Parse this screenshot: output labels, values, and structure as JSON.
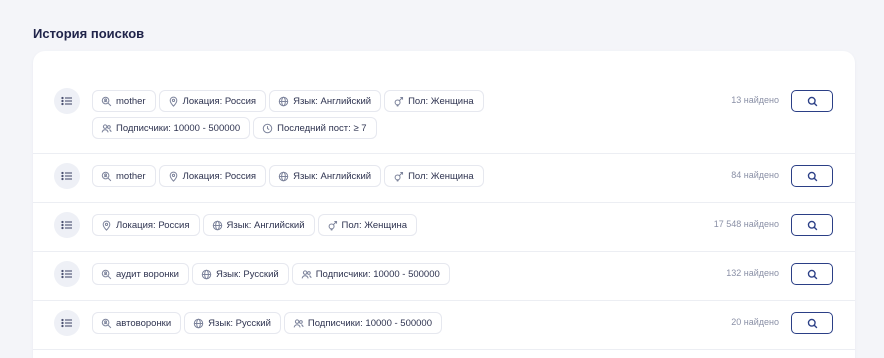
{
  "page": {
    "title": "История поисков"
  },
  "rows": [
    {
      "chips": [
        {
          "icon": "search-people-icon",
          "label": "mother"
        },
        {
          "icon": "location-pin-icon",
          "label": "Локация: Россия"
        },
        {
          "icon": "globe-icon",
          "label": "Язык: Английский"
        },
        {
          "icon": "gender-icon",
          "label": "Пол: Женщина"
        },
        {
          "icon": "followers-icon",
          "label": "Подписчики: 10000 - 500000"
        },
        {
          "icon": "clock-icon",
          "label": "Последний пост: ≥ 7"
        }
      ],
      "count": "13 найдено"
    },
    {
      "chips": [
        {
          "icon": "search-people-icon",
          "label": "mother"
        },
        {
          "icon": "location-pin-icon",
          "label": "Локация: Россия"
        },
        {
          "icon": "globe-icon",
          "label": "Язык: Английский"
        },
        {
          "icon": "gender-icon",
          "label": "Пол: Женщина"
        }
      ],
      "count": "84 найдено"
    },
    {
      "chips": [
        {
          "icon": "location-pin-icon",
          "label": "Локация: Россия"
        },
        {
          "icon": "globe-icon",
          "label": "Язык: Английский"
        },
        {
          "icon": "gender-icon",
          "label": "Пол: Женщина"
        }
      ],
      "count": "17 548 найдено"
    },
    {
      "chips": [
        {
          "icon": "search-people-icon",
          "label": "аудит воронки"
        },
        {
          "icon": "globe-icon",
          "label": "Язык: Русский"
        },
        {
          "icon": "followers-icon",
          "label": "Подписчики: 10000 - 500000"
        }
      ],
      "count": "132 найдено"
    },
    {
      "chips": [
        {
          "icon": "search-people-icon",
          "label": "автоворонки"
        },
        {
          "icon": "globe-icon",
          "label": "Язык: Русский"
        },
        {
          "icon": "followers-icon",
          "label": "Подписчики: 10000 - 500000"
        }
      ],
      "count": "20 найдено"
    }
  ],
  "colors": {
    "accent": "#2b3f86",
    "chip_border": "#e6e8ef",
    "muted": "#8a90a6"
  }
}
